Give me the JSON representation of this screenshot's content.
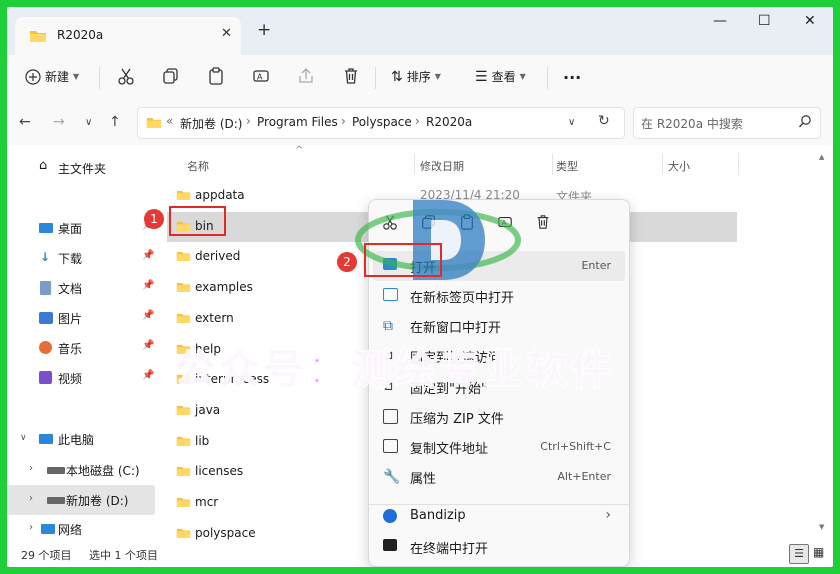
{
  "window": {
    "tab_title": "R2020a",
    "new_tab_glyph": "+",
    "tab_close_glyph": "✕",
    "controls": {
      "minimize": "—",
      "maximize": "☐",
      "close": "✕"
    }
  },
  "toolbar": {
    "new_label": "新建",
    "sort_label": "排序",
    "view_label": "查看",
    "more_glyph": "···",
    "icons": [
      "cut-icon",
      "copy-icon",
      "paste-icon",
      "rename-icon",
      "share-icon",
      "delete-icon"
    ]
  },
  "address": {
    "prefix": "«",
    "crumbs": [
      "新加卷 (D:)",
      "Program Files",
      "Polyspace",
      "R2020a"
    ],
    "search_placeholder": "在 R2020a 中搜索"
  },
  "sidebar": {
    "items": [
      {
        "label": "主文件夹",
        "icon": "home-icon"
      },
      {
        "label": "桌面",
        "icon": "desktop-icon",
        "pinned": true
      },
      {
        "label": "下载",
        "icon": "download-icon",
        "pinned": true
      },
      {
        "label": "文档",
        "icon": "document-icon",
        "pinned": true
      },
      {
        "label": "图片",
        "icon": "picture-icon",
        "pinned": true
      },
      {
        "label": "音乐",
        "icon": "music-icon",
        "pinned": true
      },
      {
        "label": "视频",
        "icon": "video-icon",
        "pinned": true
      },
      {
        "label": "此电脑",
        "icon": "pc-icon"
      },
      {
        "label": "本地磁盘 (C:)",
        "icon": "drive-icon"
      },
      {
        "label": "新加卷 (D:)",
        "icon": "drive-icon"
      },
      {
        "label": "网络",
        "icon": "network-icon"
      }
    ]
  },
  "columns": {
    "name": "名称",
    "date": "修改日期",
    "type": "类型",
    "size": "大小"
  },
  "files": [
    {
      "name": "appdata",
      "date": "2023/11/4 21:20",
      "type": "文件夹"
    },
    {
      "name": "bin"
    },
    {
      "name": "derived"
    },
    {
      "name": "examples"
    },
    {
      "name": "extern"
    },
    {
      "name": "help"
    },
    {
      "name": "interprocess"
    },
    {
      "name": "java"
    },
    {
      "name": "lib"
    },
    {
      "name": "licenses"
    },
    {
      "name": "mcr"
    },
    {
      "name": "polyspace"
    }
  ],
  "status": {
    "count": "29 个项目",
    "selected": "选中 1 个项目"
  },
  "context_menu": {
    "items": [
      {
        "label": "打开",
        "shortcut": "Enter",
        "icon": "open-icon"
      },
      {
        "label": "在新标签页中打开",
        "shortcut": "",
        "icon": "new-tab-icon"
      },
      {
        "label": "在新窗口中打开",
        "shortcut": "",
        "icon": "new-window-icon"
      },
      {
        "label": "固定到快速访问",
        "shortcut": "",
        "icon": "pin-icon"
      },
      {
        "label": "固定到\"开始\"",
        "shortcut": "",
        "icon": "pin-start-icon"
      },
      {
        "label": "压缩为 ZIP 文件",
        "shortcut": "",
        "icon": "zip-icon"
      },
      {
        "label": "复制文件地址",
        "shortcut": "Ctrl+Shift+C",
        "icon": "copy-path-icon"
      },
      {
        "label": "属性",
        "shortcut": "Alt+Enter",
        "icon": "properties-icon"
      },
      {
        "label": "Bandizip",
        "shortcut": "",
        "icon": "bandizip-icon"
      },
      {
        "label": "在终端中打开",
        "shortcut": "",
        "icon": "terminal-icon"
      }
    ],
    "submenu_glyph": "›"
  },
  "annotations": {
    "badge1": "1",
    "badge2": "2",
    "watermark": "公众号：测绘专业软件"
  },
  "colors": {
    "accent": "#0067c0",
    "folder": "#f5c242",
    "highlight_red": "#e02a2a"
  }
}
